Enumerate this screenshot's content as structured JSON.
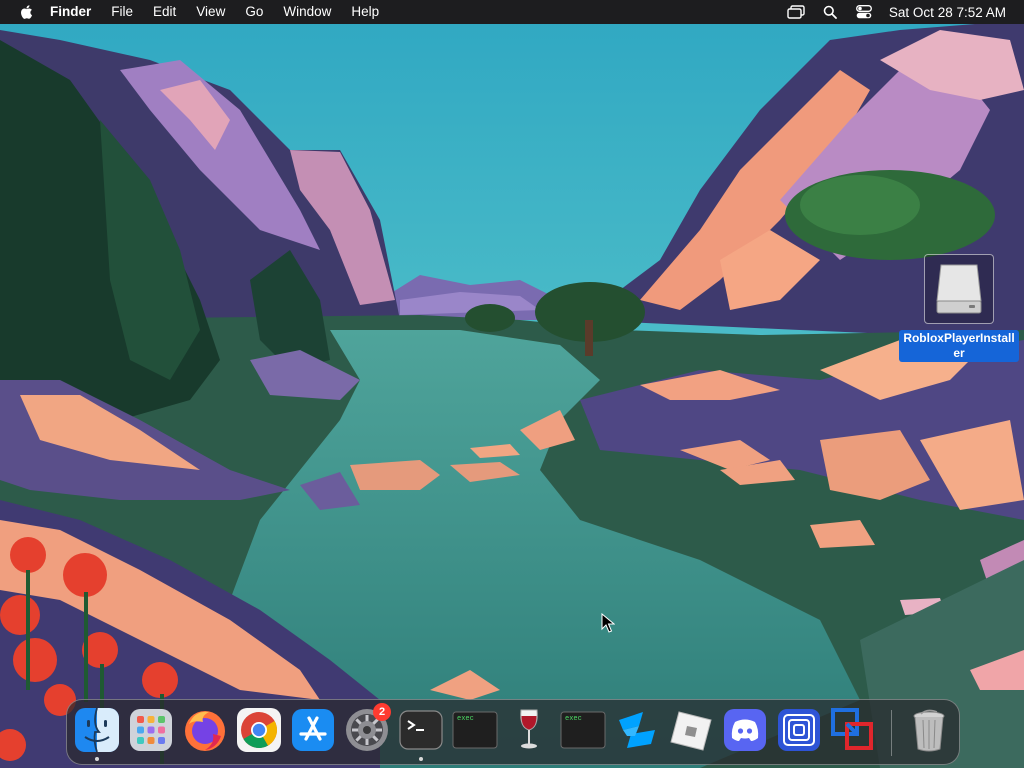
{
  "menubar": {
    "apple_icon": "apple-logo-icon",
    "app_name": "Finder",
    "menus": [
      "File",
      "Edit",
      "View",
      "Go",
      "Window",
      "Help"
    ],
    "status_icons": [
      "screen-mirroring-icon",
      "search-icon",
      "control-center-icon"
    ],
    "datetime": "Sat Oct 28  7:52 AM"
  },
  "desktop": {
    "file": {
      "name": "RobloxPlayerInstaller",
      "icon": "disk-image-icon",
      "selected": true
    }
  },
  "dock": {
    "apps": [
      {
        "name": "Finder",
        "icon": "finder-icon",
        "running": true
      },
      {
        "name": "Launchpad",
        "icon": "launchpad-icon",
        "running": false
      },
      {
        "name": "Firefox",
        "icon": "firefox-icon",
        "running": false
      },
      {
        "name": "Chrome",
        "icon": "chrome-icon",
        "running": false
      },
      {
        "name": "App Store",
        "icon": "app-store-icon",
        "running": false
      },
      {
        "name": "System Settings",
        "icon": "settings-icon",
        "running": false,
        "badge": "2"
      },
      {
        "name": "Terminal",
        "icon": "terminal-icon",
        "running": true
      },
      {
        "name": "exec",
        "icon": "exec-terminal-icon",
        "label": "exec",
        "running": false
      },
      {
        "name": "Wine",
        "icon": "wine-icon",
        "running": false
      },
      {
        "name": "exec",
        "icon": "exec-terminal-icon",
        "label": "exec",
        "running": false
      },
      {
        "name": "Roblox Studio",
        "icon": "roblox-studio-icon",
        "running": false
      },
      {
        "name": "Roblox",
        "icon": "roblox-icon",
        "running": false
      },
      {
        "name": "Discord",
        "icon": "discord-icon",
        "running": false
      },
      {
        "name": "Concentric app",
        "icon": "concentric-squares-icon",
        "running": false
      },
      {
        "name": "Parallels",
        "icon": "parallels-icon",
        "running": false
      }
    ],
    "trash": {
      "name": "Trash",
      "icon": "trash-icon"
    }
  },
  "colors": {
    "menubar": "#1d1d1f",
    "selection": "#1565d8",
    "badge": "#ff3b30"
  }
}
